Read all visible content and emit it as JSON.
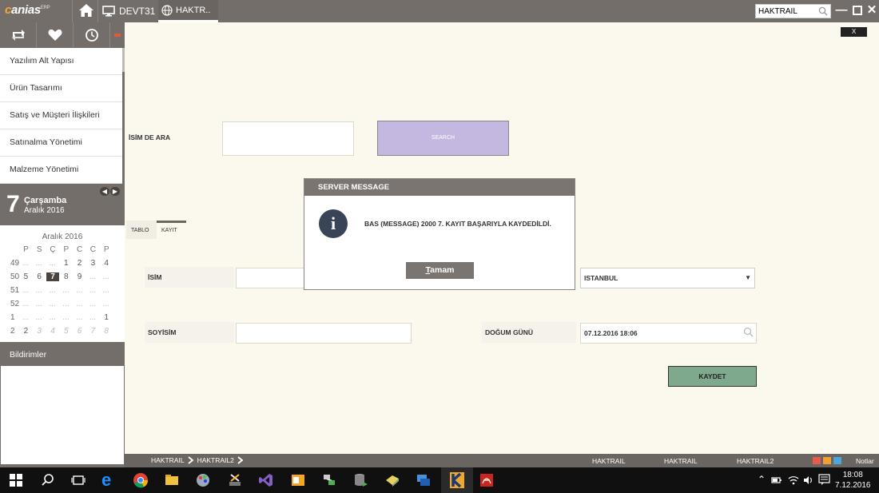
{
  "app": {
    "logo_lead": "c",
    "logo_rest": "anias",
    "logo_sup": "ERP",
    "tab_devt": "DEVT31",
    "tab_haktr": "HAKTR..",
    "search_value": "HAKTRAIL"
  },
  "sidebar": {
    "menu": [
      {
        "label": "Yazılım Alt Yapısı"
      },
      {
        "label": "Ürün Tasarımı"
      },
      {
        "label": "Satış ve Müşteri İlişkileri"
      },
      {
        "label": "Satınalma Yönetimi"
      },
      {
        "label": "Malzeme Yönetimi"
      }
    ],
    "date": {
      "day": "7",
      "weekday": "Çarşamba",
      "month_year": "Aralık 2016"
    },
    "calendar": {
      "title": "Aralık 2016",
      "headers": [
        "P",
        "S",
        "Ç",
        "P",
        "C",
        "C",
        "P"
      ],
      "weeks": [
        {
          "wk": "49",
          "days": [
            "...",
            "...",
            "...",
            "1",
            "2",
            "3",
            "4"
          ]
        },
        {
          "wk": "50",
          "days": [
            "5",
            "6",
            "7",
            "8",
            "9",
            "...",
            "..."
          ]
        },
        {
          "wk": "51",
          "days": [
            "...",
            "...",
            "...",
            "...",
            "...",
            "...",
            "..."
          ]
        },
        {
          "wk": "52",
          "days": [
            "...",
            "...",
            "...",
            "...",
            "...",
            "...",
            "..."
          ]
        },
        {
          "wk": "1",
          "days": [
            "...",
            "...",
            "...",
            "...",
            "...",
            "...",
            "1"
          ]
        },
        {
          "wk": "2",
          "days": [
            "2",
            "3",
            "4",
            "5",
            "6",
            "7",
            "8"
          ]
        }
      ],
      "today": "7"
    },
    "notifications_label": "Bildirimler"
  },
  "main": {
    "close_label": "X",
    "search_label": "İSİM DE ARA",
    "search_input_value": "",
    "search_button": "SEARCH",
    "tabs": [
      {
        "label": "TABLO"
      },
      {
        "label": "KAYIT"
      }
    ],
    "name_label": "İSİM",
    "name_value": "",
    "city_value": "ISTANBUL",
    "surname_label": "SOYİSİM",
    "surname_value": "",
    "birth_label": "DOĞUM GÜNÜ",
    "birth_value": "07.12.2016 18:06",
    "save_button": "KAYDET"
  },
  "modal": {
    "title": "SERVER MESSAGE",
    "message": "BAS (MESSAGE) 2000 7. KAYIT BAŞARIYLA KAYDEDİLDİ.",
    "ok_underline": "T",
    "ok_rest": "amam"
  },
  "statusbar": {
    "crumb1": "HAKTRAIL",
    "crumb2": "HAKTRAIL2",
    "item1": "HAKTRAIL",
    "item2": "HAKTRAIL",
    "item3": "HAKTRAIL2",
    "notes": "Notlar"
  },
  "taskbar": {
    "time": "18:08",
    "date": "7.12.2016"
  },
  "colors": {
    "header_bg": "#746e6a",
    "content_bg": "#fbf8ed",
    "search_button": "#c4b8e0",
    "save_button": "#7fa98c",
    "info_icon": "#3a4458"
  }
}
